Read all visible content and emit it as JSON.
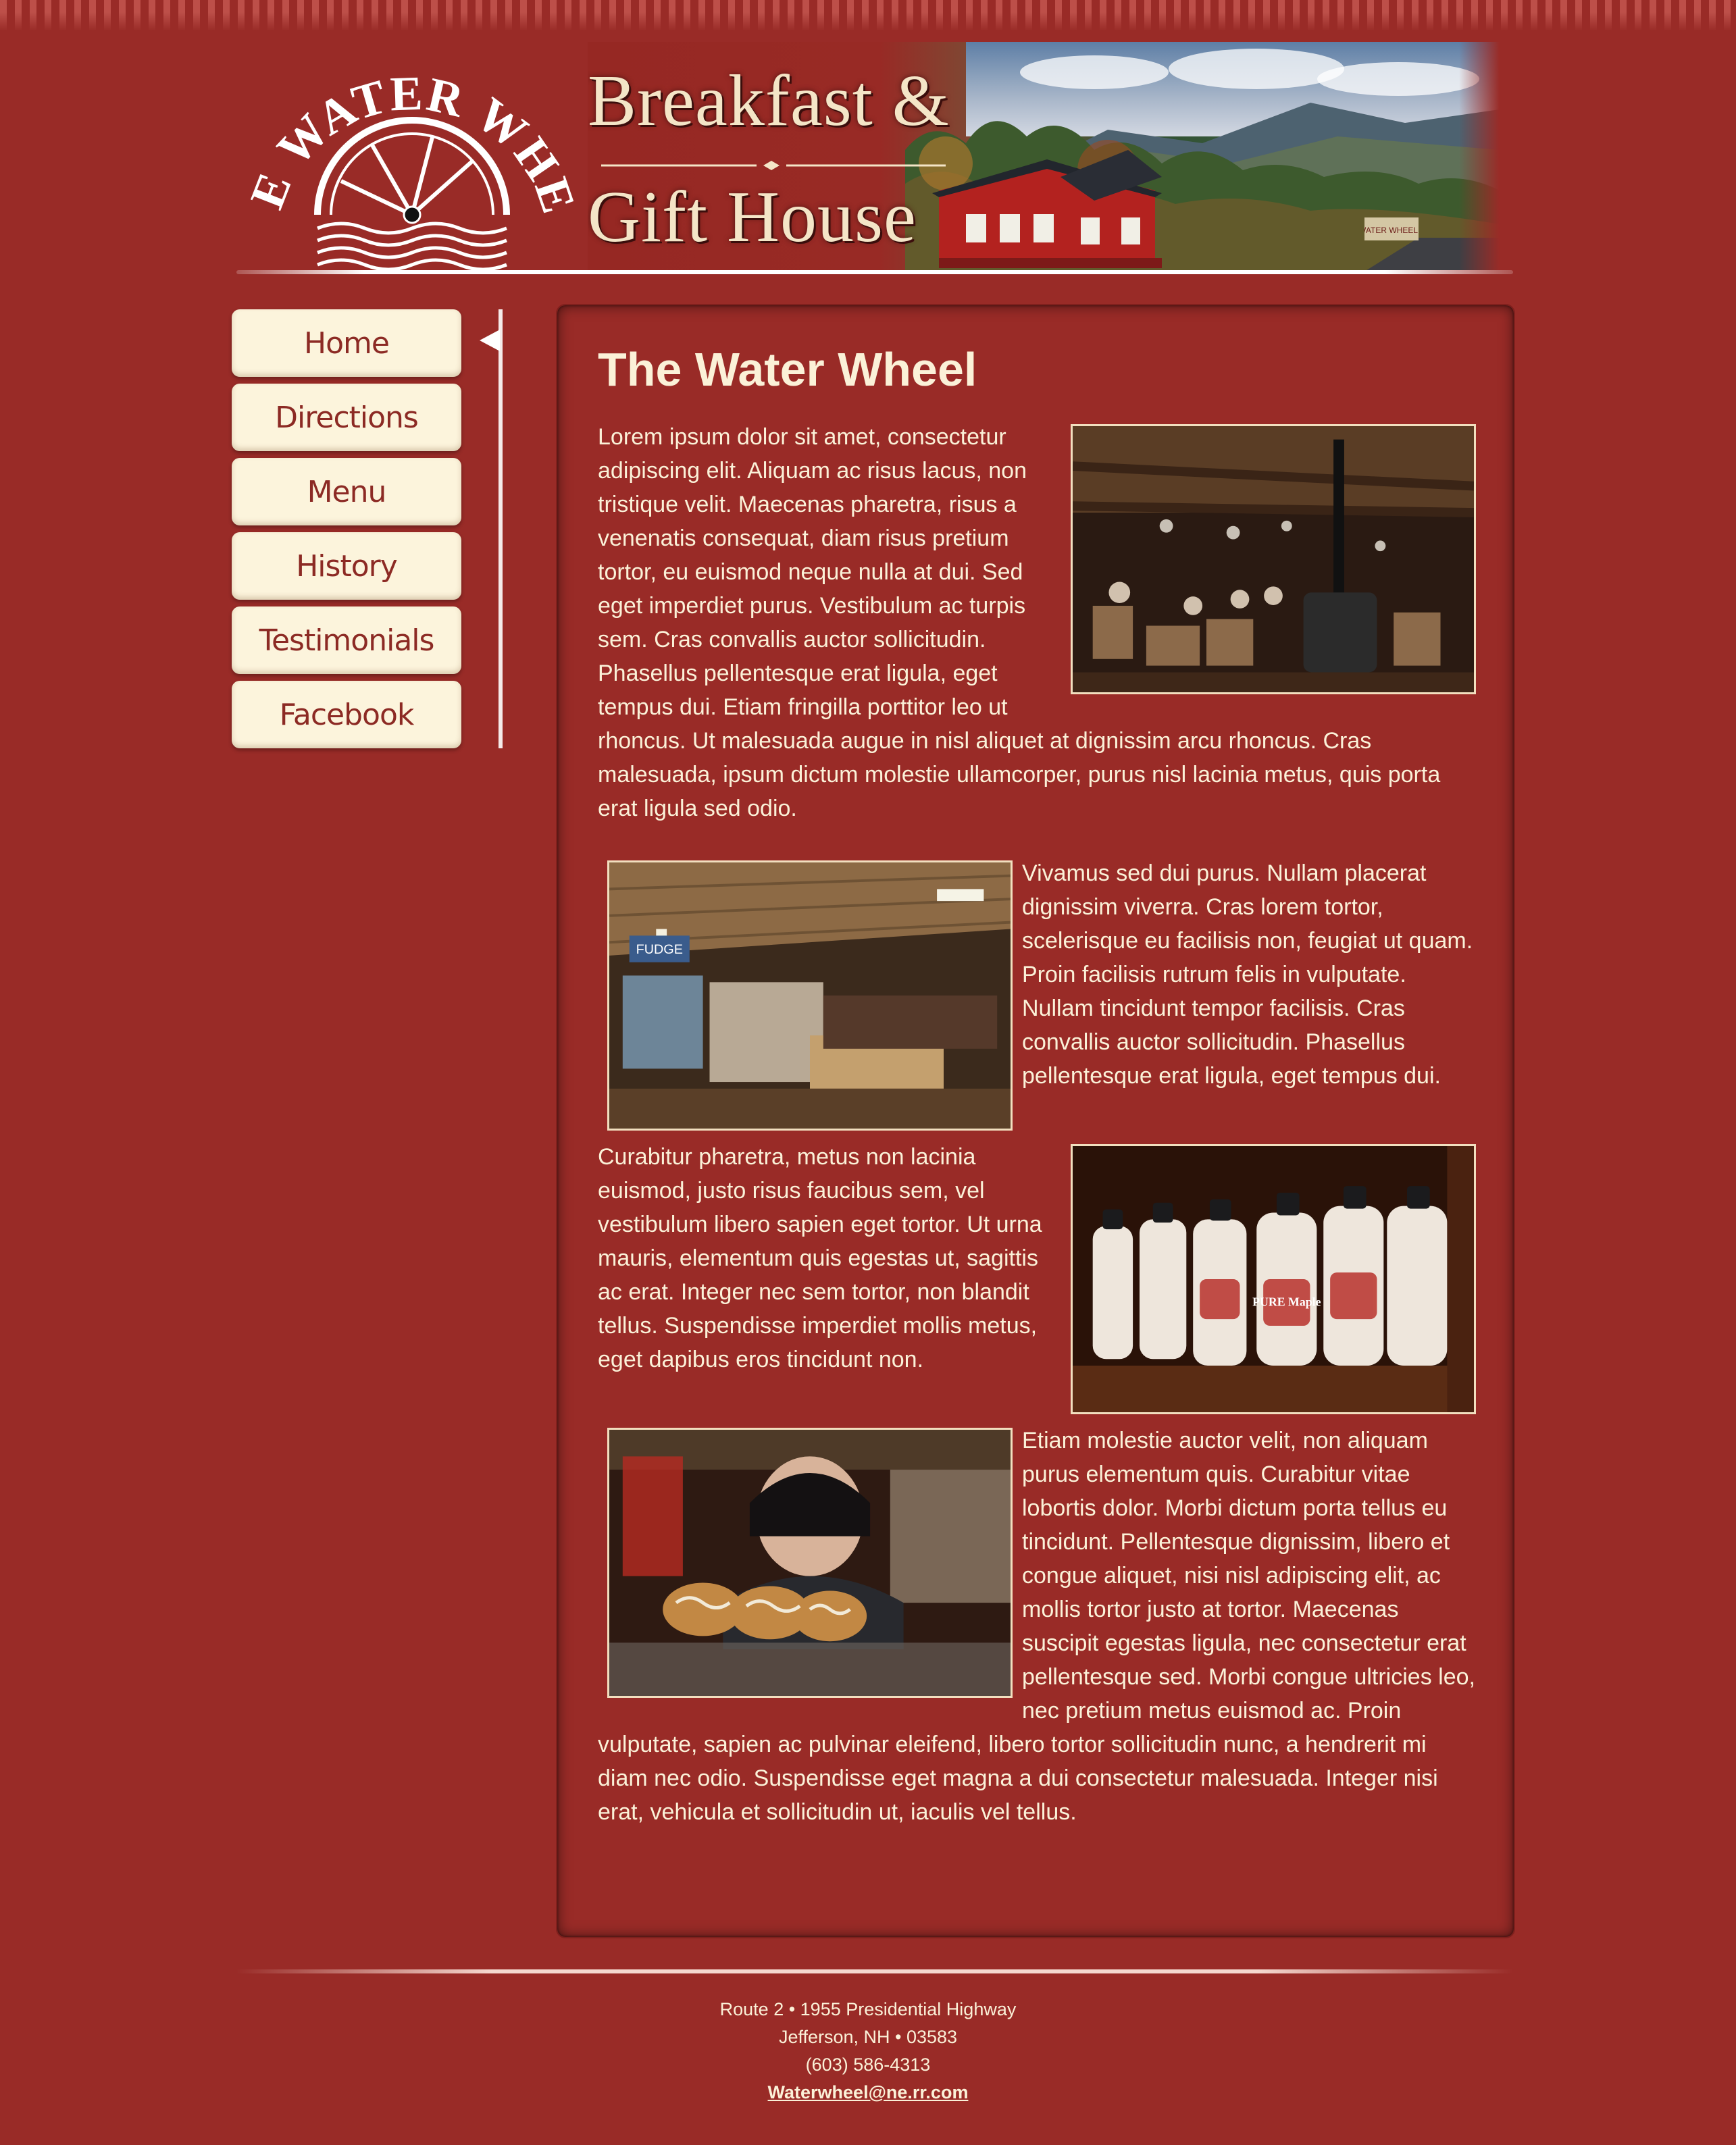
{
  "header": {
    "logo_text": "THE WATER WHEEL",
    "banner_line1": "Breakfast &",
    "banner_line2": "Gift House",
    "barn_sign": "WATER WHEEL"
  },
  "nav": {
    "items": [
      {
        "label": "Home"
      },
      {
        "label": "Directions"
      },
      {
        "label": "Menu"
      },
      {
        "label": "History"
      },
      {
        "label": "Testimonials"
      },
      {
        "label": "Facebook"
      }
    ]
  },
  "main": {
    "title": "The Water Wheel",
    "paragraphs": [
      "Lorem ipsum dolor sit amet, consectetur adipiscing elit. Aliquam ac risus lacus, non tristique velit. Maecenas pharetra, risus a venenatis consequat, diam risus pretium tortor, eu euismod neque nulla at dui. Sed eget imperdiet purus. Vestibulum ac turpis sem. Cras convallis auctor sollicitudin. Phasellus pellentesque erat ligula, eget tempus dui. Etiam fringilla porttitor leo ut rhoncus. Ut malesuada augue in nisl aliquet at dignissim arcu rhoncus. Cras malesuada, ipsum dictum molestie ullamcorper, purus nisl lacinia metus, quis porta erat ligula sed odio.",
      "Vivamus sed dui purus. Nullam placerat dignissim viverra. Cras lorem tortor, scelerisque eu facilisis non, feugiat ut quam. Proin facilisis rutrum felis in vulputate. Nullam tincidunt tempor facilisis. Cras convallis auctor sollicitudin. Phasellus pellentesque erat ligula, eget tempus dui.",
      "Curabitur pharetra, metus non lacinia euismod, justo risus faucibus sem, vel vestibulum libero sapien eget tortor. Ut urna mauris, elementum quis egestas ut, sagittis ac erat. Integer nec sem tortor, non blandit tellus. Suspendisse imperdiet mollis metus, eget dapibus eros tincidunt non.",
      "Etiam molestie auctor velit, non aliquam purus elementum quis. Curabitur vitae lobortis dolor. Morbi dictum porta tellus eu tincidunt. Pellentesque dignissim, libero et congue aliquet, nisi nisl adipiscing elit, ac mollis tortor justo at tortor. Maecenas suscipit egestas ligula, nec consectetur erat pellentesque sed. Morbi congue ultricies leo, nec pretium metus euismod ac. Proin vulputate, sapien ac pulvinar eleifend, libero tortor sollicitudin nunc, a hendrerit mi diam nec odio. Suspendisse eget magna a dui consectetur malesuada. Integer nisi erat, vehicula et sollicitudin ut, iaculis vel tellus."
    ],
    "photo_labels": {
      "gift_shop_sign": "FUDGE",
      "syrup_label": "PURE Maple"
    }
  },
  "footer": {
    "address": "Route 2 • 1955 Presidential Highway",
    "city": "Jefferson, NH • 03583",
    "phone": "(603) 586-4313",
    "email": "Waterwheel@ne.rr.com"
  },
  "colors": {
    "background": "#992b27",
    "cream": "#fbf1d8",
    "nav_text": "#8c2a24"
  }
}
